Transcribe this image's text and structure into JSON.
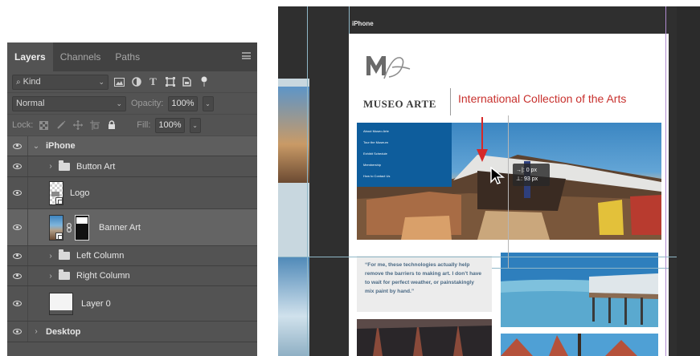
{
  "layers_panel": {
    "tabs": [
      "Layers",
      "Channels",
      "Paths"
    ],
    "filter": {
      "label": "Kind"
    },
    "blend_mode": "Normal",
    "opacity_label": "Opacity:",
    "opacity_value": "100%",
    "lock_label": "Lock:",
    "fill_label": "Fill:",
    "fill_value": "100%",
    "layers": [
      {
        "name": "iPhone",
        "type": "group",
        "expanded": true
      },
      {
        "name": "Button Art",
        "type": "group",
        "expanded": false
      },
      {
        "name": "Logo",
        "type": "smart-object"
      },
      {
        "name": "Banner Art",
        "type": "smart-object-with-mask",
        "selected": true
      },
      {
        "name": "Left Column",
        "type": "group",
        "expanded": false
      },
      {
        "name": "Right Column",
        "type": "group",
        "expanded": false
      },
      {
        "name": "Layer 0",
        "type": "layer"
      },
      {
        "name": "Desktop",
        "type": "group",
        "expanded": false
      }
    ]
  },
  "canvas": {
    "artboard_name": "iPhone",
    "site": {
      "brand": "MUSEO ARTE",
      "tagline": "International Collection of the Arts",
      "nav_items": [
        "About Museo Arte",
        "Tour the Museum",
        "Exhibit Schedule",
        "Membership",
        "How to Contact Us"
      ],
      "quote": "“For me, these technologies actually help remove the barriers to making art. I don’t have to wait for perfect weather, or painstakingly mix paint by hand.”"
    },
    "measure": {
      "dx": "0 px",
      "dy": "93 px"
    }
  },
  "colors": {
    "panel_bg": "#535353",
    "tab_bar": "#424242",
    "canvas_bg": "#2f2f2f",
    "accent_red": "#c8312e",
    "nav_blue": "#0e5d9c",
    "guide_cyan": "#8fb7c7",
    "guide_magenta": "#b08ad0"
  }
}
